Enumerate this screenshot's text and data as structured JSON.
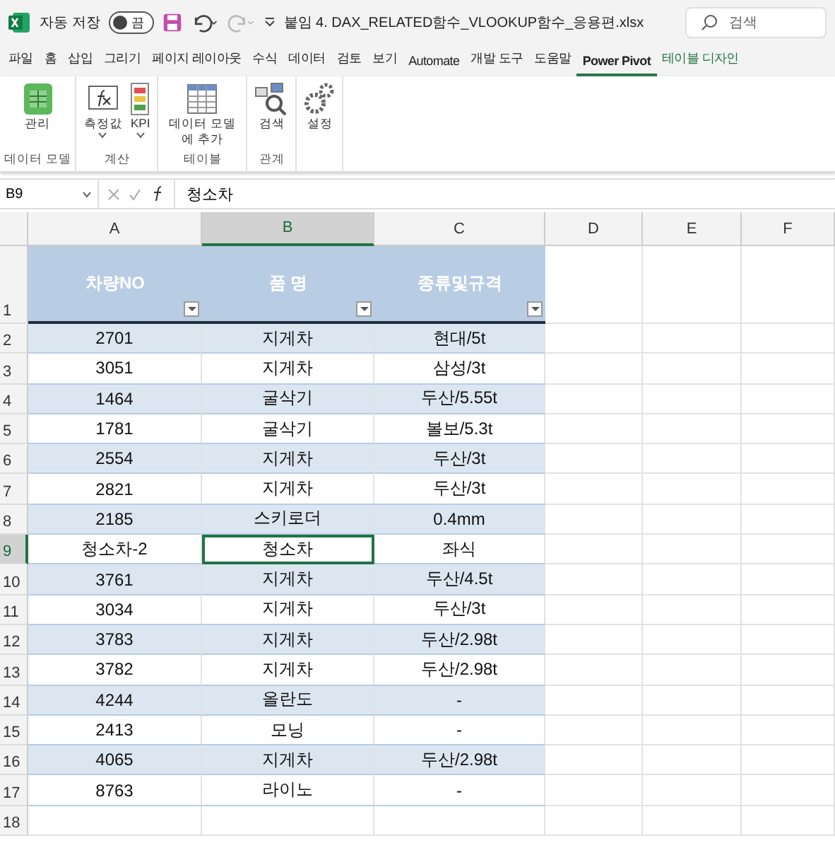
{
  "title_bar": {
    "autosave_label": "자동 저장",
    "autosave_on": false,
    "autosave_state": "끔",
    "filename": "붙임 4. DAX_RELATED함수_VLOOKUP함수_응용편.xlsx",
    "search_placeholder": "검색"
  },
  "menu_tabs": [
    {
      "label": "파일",
      "selected": false
    },
    {
      "label": "홈",
      "selected": false
    },
    {
      "label": "삽입",
      "selected": false
    },
    {
      "label": "그리기",
      "selected": false
    },
    {
      "label": "페이지 레이아웃",
      "selected": false
    },
    {
      "label": "수식",
      "selected": false
    },
    {
      "label": "데이터",
      "selected": false
    },
    {
      "label": "검토",
      "selected": false
    },
    {
      "label": "보기",
      "selected": false
    },
    {
      "label": "Automate",
      "selected": false
    },
    {
      "label": "개발 도구",
      "selected": false
    },
    {
      "label": "도움말",
      "selected": false
    },
    {
      "label": "Power Pivot",
      "selected": true
    },
    {
      "label": "테이블 디자인",
      "selected": false,
      "kind": "contextual"
    }
  ],
  "ribbon_groups": [
    {
      "label": "데이터 모델",
      "buttons": [
        {
          "label": "관리",
          "dropdown": false
        }
      ]
    },
    {
      "label": "계산",
      "buttons": [
        {
          "label": "측정값",
          "dropdown": true
        },
        {
          "label": "KPI",
          "dropdown": true
        }
      ]
    },
    {
      "label": "테이블",
      "buttons": [
        {
          "label": "데이터 모델에 추가",
          "dropdown": false
        }
      ]
    },
    {
      "label": "관계",
      "buttons": [
        {
          "label": "검색",
          "dropdown": false
        }
      ]
    },
    {
      "buttons": [
        {
          "label": "설정",
          "dropdown": false
        }
      ]
    }
  ],
  "formula_bar": {
    "name_box": "B9",
    "formula": "청소차"
  },
  "sheet": {
    "columns": [
      {
        "label": "A",
        "selected": false
      },
      {
        "label": "B",
        "selected": true
      },
      {
        "label": "C",
        "selected": false
      },
      {
        "label": "D",
        "selected": false
      },
      {
        "label": "E",
        "selected": false
      },
      {
        "label": "F",
        "selected": false
      }
    ],
    "table_headers": [
      "차량NO",
      "품 명",
      "종류및규격"
    ],
    "header_row": "1",
    "rows": [
      {
        "number": "2",
        "selected": false,
        "cells": [
          "2701",
          "지게차",
          "현대/5t"
        ]
      },
      {
        "number": "3",
        "selected": false,
        "cells": [
          "3051",
          "지게차",
          "삼성/3t"
        ]
      },
      {
        "number": "4",
        "selected": false,
        "cells": [
          "1464",
          "굴삭기",
          "두산/5.55t"
        ]
      },
      {
        "number": "5",
        "selected": false,
        "cells": [
          "1781",
          "굴삭기",
          "볼보/5.3t"
        ]
      },
      {
        "number": "6",
        "selected": false,
        "cells": [
          "2554",
          "지게차",
          "두산/3t"
        ]
      },
      {
        "number": "7",
        "selected": false,
        "cells": [
          "2821",
          "지게차",
          "두산/3t"
        ]
      },
      {
        "number": "8",
        "selected": false,
        "cells": [
          "2185",
          "스키로더",
          "0.4mm"
        ]
      },
      {
        "number": "9",
        "selected": true,
        "cells": [
          "청소차-2",
          "청소차",
          "좌식"
        ]
      },
      {
        "number": "10",
        "selected": false,
        "cells": [
          "3761",
          "지게차",
          "두산/4.5t"
        ]
      },
      {
        "number": "11",
        "selected": false,
        "cells": [
          "3034",
          "지게차",
          "두산/3t"
        ]
      },
      {
        "number": "12",
        "selected": false,
        "cells": [
          "3783",
          "지게차",
          "두산/2.98t"
        ]
      },
      {
        "number": "13",
        "selected": false,
        "cells": [
          "3782",
          "지게차",
          "두산/2.98t"
        ]
      },
      {
        "number": "14",
        "selected": false,
        "cells": [
          "4244",
          "올란도",
          "-"
        ]
      },
      {
        "number": "15",
        "selected": false,
        "cells": [
          "2413",
          "모닝",
          "-"
        ]
      },
      {
        "number": "16",
        "selected": false,
        "cells": [
          "4065",
          "지게차",
          "두산/2.98t"
        ]
      },
      {
        "number": "17",
        "selected": false,
        "cells": [
          "8763",
          "라이노",
          "-"
        ]
      },
      {
        "number": "18",
        "selected": false,
        "cells": []
      }
    ]
  }
}
